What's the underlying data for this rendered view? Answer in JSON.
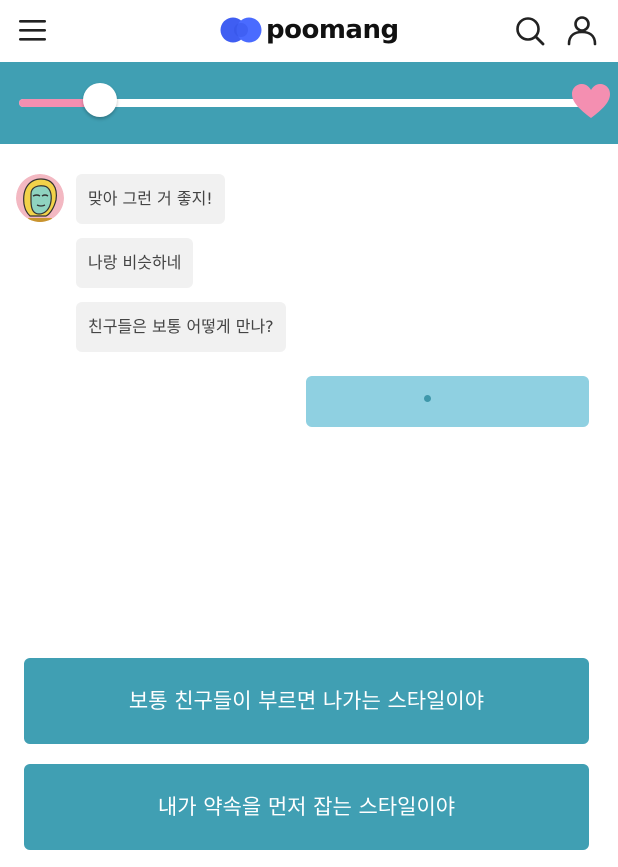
{
  "header": {
    "brand": "poomang",
    "menu_icon": "hamburger-menu-icon",
    "search_icon": "search-icon",
    "user_icon": "user-icon"
  },
  "progress": {
    "fraction": 0.145,
    "track_color": "#ffffff",
    "fill_color": "#f48fb1",
    "band_color": "#409fb3",
    "goal_icon": "heart-icon"
  },
  "chat": {
    "avatar_icon": "character-avatar",
    "messages": [
      {
        "text": "맞아 그런 거 좋지!"
      },
      {
        "text": "나랑 비슷하네"
      },
      {
        "text": "친구들은 보통 어떻게 만나?"
      }
    ],
    "typing_indicator_color": "#8fd0e1"
  },
  "answers": [
    {
      "label": "보통 친구들이 부르면 나가는 스타일이야"
    },
    {
      "label": "내가 약속을 먼저 잡는 스타일이야"
    }
  ]
}
